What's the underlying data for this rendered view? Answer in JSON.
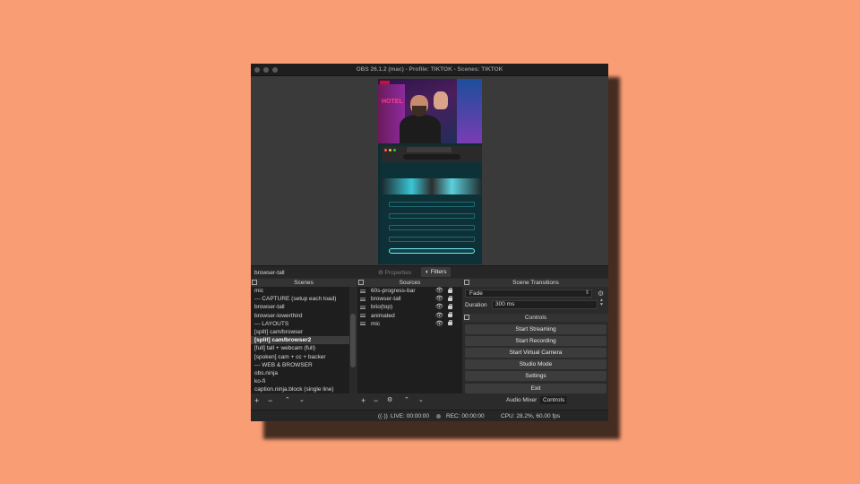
{
  "window": {
    "title": "OBS 26.1.2 (mac) - Profile: TIKTOK - Scenes: TIKTOK"
  },
  "source_bar": {
    "current_source": "browser-tall",
    "properties_label": "Properties",
    "filters_label": "Filters"
  },
  "docks": {
    "scenes_title": "Scenes",
    "sources_title": "Sources",
    "transitions_title": "Scene Transitions",
    "controls_title": "Controls"
  },
  "scenes": [
    {
      "label": "mic",
      "selected": false
    },
    {
      "label": "--- CAPTURE (setup each load)",
      "selected": false
    },
    {
      "label": "browser-tall",
      "selected": false
    },
    {
      "label": "browser-lowerthird",
      "selected": false
    },
    {
      "label": "--- LAYOUTS",
      "selected": false
    },
    {
      "label": "[split] cam/browser",
      "selected": false
    },
    {
      "label": "[split] cam/browser2",
      "selected": true
    },
    {
      "label": "[full] tall + webcam (full)",
      "selected": false
    },
    {
      "label": "[spoken] cam + cc + backer",
      "selected": false
    },
    {
      "label": "--- WEB & BROWSER",
      "selected": false
    },
    {
      "label": "obs.ninja",
      "selected": false
    },
    {
      "label": "ko-fi",
      "selected": false
    },
    {
      "label": "caption.ninja.block (single line)",
      "selected": false
    }
  ],
  "sources": [
    {
      "label": "60s-progress-bar"
    },
    {
      "label": "browser-tall"
    },
    {
      "label": "brio(top)"
    },
    {
      "label": "animated"
    },
    {
      "label": "mic"
    }
  ],
  "transitions": {
    "selected": "Fade",
    "duration_label": "Duration",
    "duration_value": "300 ms"
  },
  "controls": {
    "start_streaming": "Start Streaming",
    "start_recording": "Start Recording",
    "start_virtual_camera": "Start Virtual Camera",
    "studio_mode": "Studio Mode",
    "settings": "Settings",
    "exit": "Exit"
  },
  "bottom_tabs": {
    "audio_mixer": "Audio Mixer",
    "controls": "Controls"
  },
  "preview": {
    "neon_text": "HOTEL",
    "browser_links": [
      "OBS Free Tricks (see Online) ->",
      "Buy me a Beverage Ko-fi?",
      "OBS/Game & Bakin Downsized",
      "OBS & Dropbox on Ubuntu",
      "I'm a Curry Pie Ramen"
    ]
  },
  "status": {
    "live": "LIVE: 00:00:00",
    "rec": "REC: 00:00:00",
    "cpu": "CPU: 28.2%, 60.00 fps"
  },
  "colors": {
    "background": "#F89D74",
    "window": "#2B2B2B",
    "list_bg": "#1E1E1E",
    "button": "#3C3C3C",
    "accent_teal": "#7CE8F0"
  }
}
